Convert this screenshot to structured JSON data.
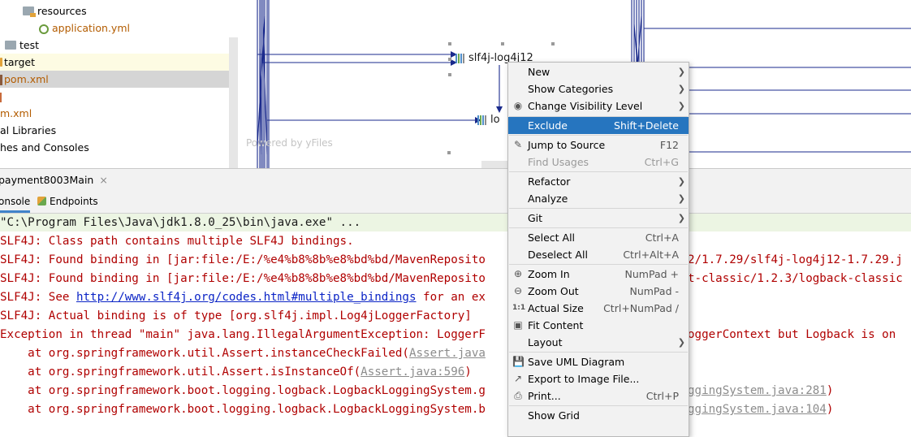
{
  "project_tree": {
    "items": [
      {
        "label": "resources",
        "icon": "folder-resources-icon"
      },
      {
        "label": "application.yml",
        "icon": "yaml-file-icon"
      },
      {
        "label": "test",
        "icon": "folder-icon"
      },
      {
        "label": "target",
        "icon": "folder-icon"
      },
      {
        "label": "pom.xml",
        "icon": "maven-file-icon"
      },
      {
        "label": "m.xml",
        "icon": "maven-file-icon"
      },
      {
        "label": "al Libraries",
        "icon": "library-icon"
      },
      {
        "label": "hes and Consoles",
        "icon": "scratch-icon"
      }
    ]
  },
  "diagram": {
    "watermark": "Powered by yFiles",
    "nodes": [
      {
        "label": "slf4j-log4j12"
      },
      {
        "label": "lo"
      }
    ]
  },
  "run_panel": {
    "title": "payment8003Main",
    "close_label": "×",
    "tabs": [
      {
        "label": "onsole"
      },
      {
        "label": "Endpoints"
      }
    ]
  },
  "console": {
    "lines": [
      "\"C:\\Program Files\\Java\\jdk1.8.0_25\\bin\\java.exe\" ...",
      "SLF4J: Class path contains multiple SLF4J bindings.",
      "SLF4J: Found binding in [jar:file:/E:/%e4%b8%8b%e8%bd%bd/MavenReposito",
      "SLF4J: Found binding in [jar:file:/E:/%e4%b8%8b%e8%bd%bd/MavenReposito",
      "SLF4J: See ",
      "SLF4J: Actual binding is of type [org.slf4j.impl.Log4jLoggerFactory]",
      "Exception in thread \"main\" java.lang.IllegalArgumentException: LoggerF",
      "    at org.springframework.util.Assert.instanceCheckFailed(",
      "    at org.springframework.util.Assert.isInstanceOf(",
      "    at org.springframework.boot.logging.logback.LogbackLoggingSystem.g",
      "    at org.springframework.boot.logging.logback.LogbackLoggingSystem.b"
    ],
    "link_url": "http://www.slf4j.org/codes.html#multiple_bindings",
    "link_suffix": " for an ex",
    "assert_link_1": "Assert.java",
    "assert_link_2": "Assert.java:596",
    "assert_close_2": ")",
    "right_1": "2/1.7.29/slf4j-log4j12-1.7.29.j",
    "right_2": "t-classic/1.2.3/logback-classic",
    "right_3": "oggerContext but Logback is on",
    "right_4_link": "ggingSystem.java:281",
    "right_4_close": ")",
    "right_5_link": "ggingSystem.java:104",
    "right_5_close": ")"
  },
  "context_menu": {
    "items": [
      {
        "label": "New",
        "submenu": true
      },
      {
        "label": "Show Categories",
        "submenu": true
      },
      {
        "label": "Change Visibility Level",
        "submenu": true,
        "icon": "eye-icon"
      },
      {
        "label": "Exclude",
        "shortcut": "Shift+Delete",
        "selected": true
      },
      {
        "label": "Jump to Source",
        "shortcut": "F12",
        "icon": "pencil-icon"
      },
      {
        "label": "Find Usages",
        "shortcut": "Ctrl+G",
        "disabled": true
      },
      {
        "label": "Refactor",
        "submenu": true
      },
      {
        "label": "Analyze",
        "submenu": true
      },
      {
        "label": "Git",
        "submenu": true
      },
      {
        "label": "Select All",
        "shortcut": "Ctrl+A"
      },
      {
        "label": "Deselect All",
        "shortcut": "Ctrl+Alt+A"
      },
      {
        "label": "Zoom In",
        "shortcut": "NumPad +",
        "icon": "zoom-in-icon"
      },
      {
        "label": "Zoom Out",
        "shortcut": "NumPad -",
        "icon": "zoom-out-icon"
      },
      {
        "label": "Actual Size",
        "shortcut": "Ctrl+NumPad /",
        "icon": "actual-size-icon"
      },
      {
        "label": "Fit Content",
        "icon": "fit-content-icon"
      },
      {
        "label": "Layout",
        "submenu": true
      },
      {
        "label": "Save UML Diagram",
        "icon": "save-icon"
      },
      {
        "label": "Export to Image File...",
        "icon": "export-icon"
      },
      {
        "label": "Print...",
        "shortcut": "Ctrl+P",
        "icon": "print-icon"
      },
      {
        "label": "Show Grid"
      }
    ]
  },
  "colors": {
    "selection": "#2675bf",
    "error_text": "#b00000",
    "link": "#0b24c6",
    "diagram_edge": "#1a2a8c",
    "command_bg": "#ecf5e3"
  }
}
